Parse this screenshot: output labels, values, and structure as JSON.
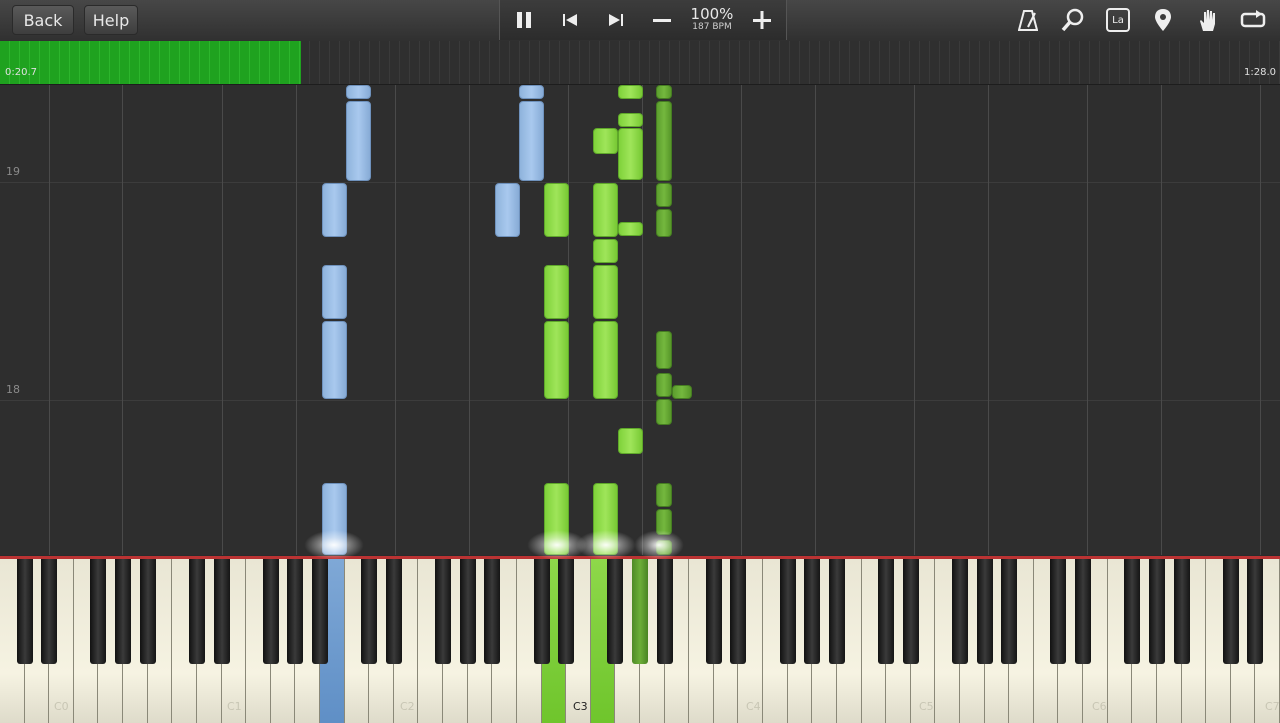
{
  "toolbar": {
    "back_label": "Back",
    "help_label": "Help",
    "speed": "100%",
    "bpm": "187 BPM",
    "icons": [
      "pause-icon",
      "skip-back-icon",
      "skip-forward-icon",
      "minus-icon",
      "plus-icon",
      "metronome-icon",
      "magnifier-icon",
      "note-labels-icon",
      "marker-icon",
      "hand-icon",
      "loop-icon"
    ],
    "note_labels_glyph": "La"
  },
  "progress": {
    "elapsed": "0:20.7",
    "total": "1:28.0",
    "fraction": 0.235,
    "color": "#27b027"
  },
  "roll": {
    "measures": [
      "19",
      "18"
    ]
  },
  "keyboard": {
    "octave_labels": [
      "C0",
      "C1",
      "C2",
      "C3",
      "C4",
      "C5",
      "C6",
      "C7"
    ]
  },
  "colors": {
    "left_hand": "#a3c3e8",
    "right_hand_light": "#8fdc4a",
    "right_hand_dark": "#6aae38"
  }
}
